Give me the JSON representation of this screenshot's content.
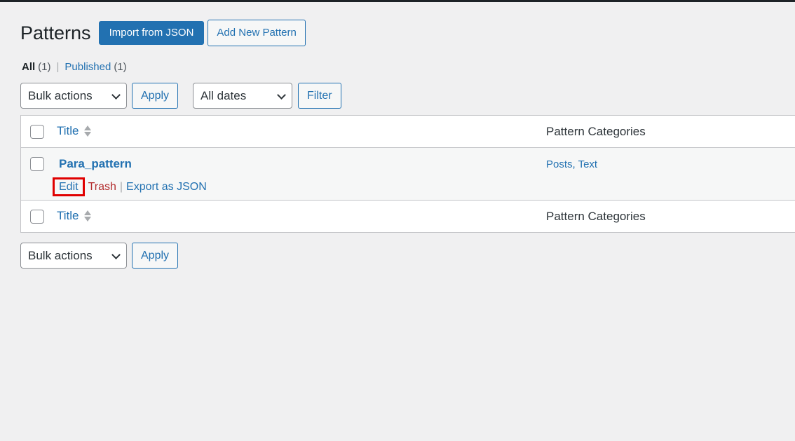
{
  "page": {
    "title": "Patterns",
    "import_button": "Import from JSON",
    "add_new_button": "Add New Pattern"
  },
  "filters": {
    "all_label": "All",
    "all_count": "(1)",
    "published_label": "Published",
    "published_count": "(1)"
  },
  "tablenav_top": {
    "bulk_actions": "Bulk actions",
    "apply": "Apply",
    "dates": "All dates",
    "filter": "Filter"
  },
  "table": {
    "header": {
      "title": "Title",
      "categories": "Pattern Categories"
    },
    "rows": [
      {
        "title": "Para_pattern",
        "actions": {
          "edit": "Edit",
          "trash": "Trash",
          "export": "Export as JSON"
        },
        "categories": "Posts, Text"
      }
    ],
    "footer": {
      "title": "Title",
      "categories": "Pattern Categories"
    }
  },
  "tablenav_bottom": {
    "bulk_actions": "Bulk actions",
    "apply": "Apply"
  },
  "colors": {
    "accent": "#2271b1",
    "trash": "#b32d2e",
    "highlight": "#e00000",
    "background": "#f0f0f1"
  }
}
